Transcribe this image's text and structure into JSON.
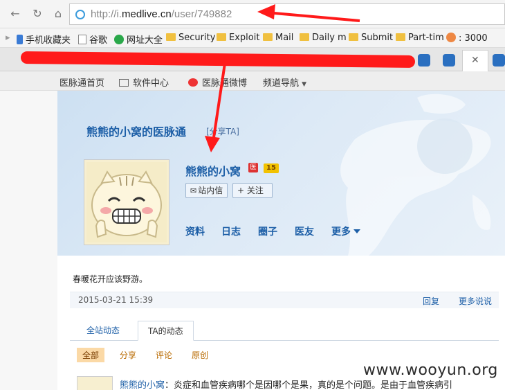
{
  "browser": {
    "url_prefix": "http://i.",
    "url_domain": "medlive.cn",
    "url_path": "/user/749882",
    "bookmarks": [
      "手机收藏夹",
      "谷歌",
      "网址大全",
      "Security",
      "Exploit",
      "Mail",
      "Daily m",
      "Submit",
      "Part-tim",
      ": 3000"
    ]
  },
  "site_nav": {
    "items": [
      "医脉通首页",
      "软件中心",
      "医脉通微博",
      "频道导航"
    ]
  },
  "profile": {
    "site_title": "熊熊的小窝的医脉通",
    "share_label": "[分享TA]",
    "user_name": "熊熊的小窝",
    "badge_yi": "医",
    "level": "15",
    "message_button": "站内信",
    "follow_button": "+ 关注",
    "tabs": [
      "资料",
      "日志",
      "圈子",
      "医友",
      "更多"
    ]
  },
  "post": {
    "text": "春暖花开应该野游。",
    "date": "2015-03-21 15:39",
    "reply": "回复",
    "more": "更多说说"
  },
  "feed_tabs": [
    "全站动态",
    "TA的动态"
  ],
  "filters": [
    "全部",
    "分享",
    "评论",
    "原创"
  ],
  "feed_item": {
    "user": "熊熊的小窝",
    "text": "：炎症和血管疾病哪个是因哪个是果，真的是个问题。是由于血管疾病引"
  },
  "watermark": "www.wooyun.org",
  "colors": {
    "link": "#1d5fa7",
    "annotation": "#ff1a1a"
  }
}
